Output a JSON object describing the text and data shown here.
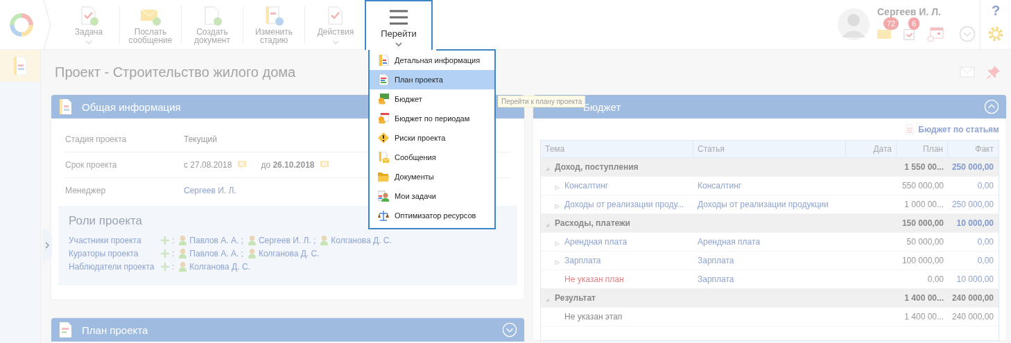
{
  "toolbar": [
    {
      "label": "Задача",
      "caret": true,
      "selected": false
    },
    {
      "label": "Послать сообщение",
      "caret": false,
      "selected": false
    },
    {
      "label": "Создать документ",
      "caret": false,
      "selected": false
    },
    {
      "label": "Изменить стадию",
      "caret": false,
      "selected": false
    },
    {
      "label": "Действия",
      "caret": true,
      "selected": false
    },
    {
      "label": "Перейти",
      "caret": true,
      "selected": true
    }
  ],
  "user": {
    "name": "Сергеев И. Л.",
    "mail_count": "72",
    "task_count": "6"
  },
  "help": "?",
  "page_title": "Проект - Строительство жилого дома",
  "general": {
    "title": "Общая информация",
    "fields": [
      {
        "label": "Стадия проекта",
        "kind": "text",
        "values": [
          "Текущий"
        ]
      },
      {
        "label": "Срок проекта",
        "kind": "dates",
        "values": [
          "с 27.08.2018",
          "до **26.10.2018**"
        ]
      },
      {
        "label": "Менеджер",
        "kind": "link",
        "values": [
          "Сергеев И. Л."
        ]
      }
    ],
    "roles_title": "Роли проекта",
    "roles": [
      {
        "label": "Участники проекта",
        "separator": ":",
        "people": [
          "Павлов А. А. ;",
          "Сергеев И. Л. ;",
          "Колганова Д. С."
        ]
      },
      {
        "label": "Кураторы проекта",
        "separator": ":",
        "people": [
          "Павлов А. А. ;",
          "Колганова Д. С."
        ]
      },
      {
        "label": "Наблюдатели проекта",
        "separator": ":",
        "people": [
          "Колганова Д. С."
        ]
      }
    ]
  },
  "plan_panel": {
    "title": "План проекта"
  },
  "menu": [
    {
      "label": "Детальная информация",
      "selected": false
    },
    {
      "label": "План проекта",
      "selected": true
    },
    {
      "label": "Бюджет",
      "selected": false
    },
    {
      "label": "Бюджет по периодам",
      "selected": false
    },
    {
      "label": "Риски проекта",
      "selected": false
    },
    {
      "label": "Сообщения",
      "selected": false
    },
    {
      "label": "Документы",
      "selected": false
    },
    {
      "label": "Мои задачи",
      "selected": false
    },
    {
      "label": "Оптимизатор ресурсов",
      "selected": false
    }
  ],
  "tooltip": "Перейти к плану проекта",
  "budget": {
    "title": "Бюджет",
    "link": "Бюджет по статьям",
    "columns": [
      "Тема",
      "Статья",
      "Дата",
      "План",
      "Факт"
    ],
    "rows": [
      {
        "kind": "group",
        "expanded": true,
        "theme": "Доход, поступления",
        "plan": "1 550 00...",
        "fact": "250 000,00",
        "fact_link": true
      },
      {
        "kind": "link",
        "expanded": false,
        "theme": "Консалтинг",
        "article": "Консалтинг",
        "plan": "550 000,00",
        "fact": "0,00",
        "fact_link": true
      },
      {
        "kind": "link",
        "expanded": false,
        "theme": "Доходы от реализации проду...",
        "article": "Доходы от реализации продукции",
        "plan": "1 000 00...",
        "fact": "250 000,00",
        "fact_link": true
      },
      {
        "kind": "group",
        "expanded": true,
        "theme": "Расходы, платежи",
        "plan": "150 000,00",
        "fact": "10 000,00",
        "fact_link": true
      },
      {
        "kind": "link",
        "expanded": false,
        "theme": "Арендная плата",
        "article": "Арендная плата",
        "plan": "50 000,00",
        "fact": "0,00",
        "fact_link": true
      },
      {
        "kind": "link",
        "expanded": false,
        "theme": "Зарплата",
        "article": "Зарплата",
        "plan": "100 000,00",
        "fact": "0,00",
        "fact_link": true
      },
      {
        "kind": "missing",
        "theme": "Не указан план",
        "article": "Зарплата",
        "plan": "0,00",
        "fact": "10 000,00",
        "fact_link": true
      },
      {
        "kind": "group",
        "expanded": true,
        "theme": "Результат",
        "plan": "1 400 00...",
        "fact": "240 000,00",
        "fact_link": false
      },
      {
        "kind": "plain",
        "theme": "Не указан этап",
        "plan": "1 400 00...",
        "fact": "240 000,00",
        "fact_link": false
      }
    ]
  }
}
